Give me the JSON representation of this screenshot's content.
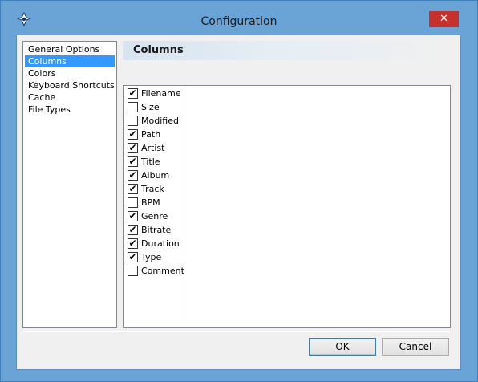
{
  "window": {
    "title": "Configuration",
    "close_symbol": "✕",
    "app_icon": "app-logo-icon"
  },
  "sidebar": {
    "items": [
      {
        "label": "General Options",
        "selected": false
      },
      {
        "label": "Columns",
        "selected": true
      },
      {
        "label": "Colors",
        "selected": false
      },
      {
        "label": "Keyboard Shortcuts",
        "selected": false
      },
      {
        "label": "Cache",
        "selected": false
      },
      {
        "label": "File Types",
        "selected": false
      }
    ]
  },
  "section": {
    "title": "Columns"
  },
  "columns": [
    {
      "label": "Filename",
      "checked": true
    },
    {
      "label": "Size",
      "checked": false
    },
    {
      "label": "Modified",
      "checked": false
    },
    {
      "label": "Path",
      "checked": true
    },
    {
      "label": "Artist",
      "checked": true
    },
    {
      "label": "Title",
      "checked": true
    },
    {
      "label": "Album",
      "checked": true
    },
    {
      "label": "Track",
      "checked": true
    },
    {
      "label": "BPM",
      "checked": false
    },
    {
      "label": "Genre",
      "checked": true
    },
    {
      "label": "Bitrate",
      "checked": true
    },
    {
      "label": "Duration",
      "checked": true
    },
    {
      "label": "Type",
      "checked": true
    },
    {
      "label": "Comment",
      "checked": false
    }
  ],
  "buttons": {
    "ok_label": "OK",
    "cancel_label": "Cancel"
  },
  "colors": {
    "window_frame": "#6aa3d6",
    "close_button": "#c7312b",
    "selection": "#3399ff"
  }
}
